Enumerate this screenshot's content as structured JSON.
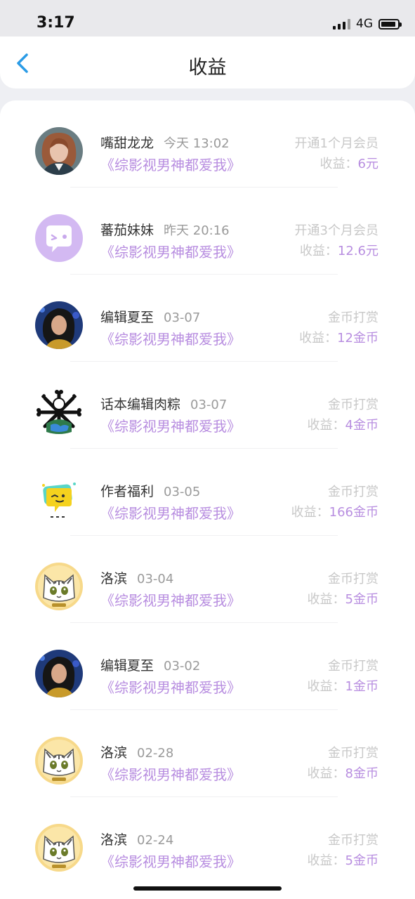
{
  "status_bar": {
    "time": "3:17",
    "network": "4G"
  },
  "header": {
    "title": "收益",
    "back_icon": "chevron-left-icon"
  },
  "colors": {
    "accent": "#b88ee0",
    "back_icon": "#2a9be6",
    "muted": "#c8c8c8"
  },
  "rows": [
    {
      "name": "嘴甜龙龙",
      "time": "今天 13:02",
      "book": "《综影视男神都爱我》",
      "type": "开通1个月会员",
      "label": "收益：",
      "amount": "6元",
      "avatar": "woman-portrait"
    },
    {
      "name": "蕃茄妹妹",
      "time": "昨天 20:16",
      "book": "《综影视男神都爱我》",
      "type": "开通3个月会员",
      "label": "收益：",
      "amount": "12.6元",
      "avatar": "purple-chat-bubble"
    },
    {
      "name": "编辑夏至",
      "time": "03-07",
      "book": "《综影视男神都爱我》",
      "type": "金币打赏",
      "label": "收益：",
      "amount": "12金币",
      "avatar": "woman-dark-hair"
    },
    {
      "name": "话本编辑肉粽",
      "time": "03-07",
      "book": "《综影视男神都爱我》",
      "type": "金币打赏",
      "label": "收益：",
      "amount": "4金币",
      "avatar": "bone-globe"
    },
    {
      "name": "作者福利",
      "time": "03-05",
      "book": "《综影视男神都爱我》",
      "type": "金币打赏",
      "label": "收益：",
      "amount": "166金币",
      "avatar": "yellow-wink"
    },
    {
      "name": "洛滨",
      "time": "03-04",
      "book": "《综影视男神都爱我》",
      "type": "金币打赏",
      "label": "收益：",
      "amount": "5金币",
      "avatar": "cartoon-cat"
    },
    {
      "name": "编辑夏至",
      "time": "03-02",
      "book": "《综影视男神都爱我》",
      "type": "金币打赏",
      "label": "收益：",
      "amount": "1金币",
      "avatar": "woman-dark-hair"
    },
    {
      "name": "洛滨",
      "time": "02-28",
      "book": "《综影视男神都爱我》",
      "type": "金币打赏",
      "label": "收益：",
      "amount": "8金币",
      "avatar": "cartoon-cat"
    },
    {
      "name": "洛滨",
      "time": "02-24",
      "book": "《综影视男神都爱我》",
      "type": "金币打赏",
      "label": "收益：",
      "amount": "5金币",
      "avatar": "cartoon-cat"
    }
  ]
}
